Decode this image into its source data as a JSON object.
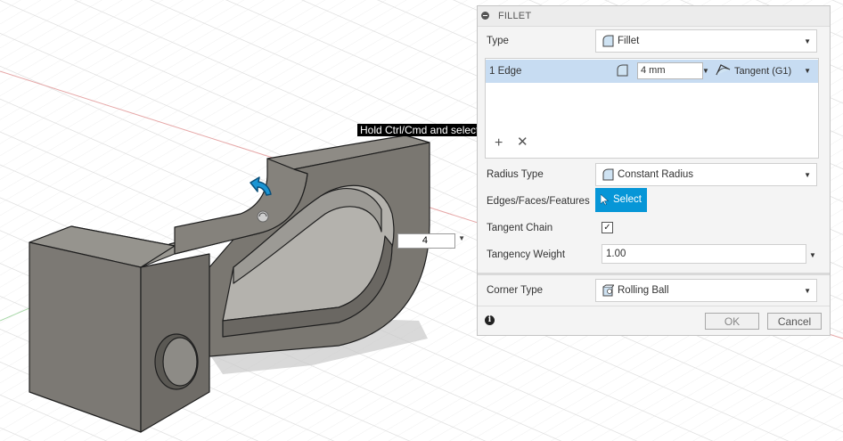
{
  "tooltip": "Hold Ctrl/Cmd and select edges, faces, or features to modify selection",
  "inline_input": {
    "value": "4"
  },
  "dialog": {
    "title": "FILLET",
    "type": {
      "label": "Type",
      "value": "Fillet"
    },
    "edges": {
      "label": "1 Edge",
      "radius": "4 mm",
      "continuity": "Tangent (G1)"
    },
    "radius_type": {
      "label": "Radius Type",
      "value": "Constant Radius"
    },
    "edges_faces_features": {
      "label": "Edges/Faces/Features",
      "button": "Select"
    },
    "tangent_chain": {
      "label": "Tangent Chain",
      "checked": true
    },
    "tangency_weight": {
      "label": "Tangency Weight",
      "value": "1.00"
    },
    "corner_type": {
      "label": "Corner Type",
      "value": "Rolling Ball"
    },
    "ok": "OK",
    "cancel": "Cancel"
  },
  "colors": {
    "accent": "#0696d7",
    "selection_row": "#c7dcf2",
    "model_gray": "#8a8780"
  },
  "icons": [
    "fillet-icon",
    "tangent-icon",
    "constant-radius-icon",
    "rolling-ball-icon",
    "cursor-icon",
    "info-icon",
    "add-icon",
    "remove-icon",
    "move-arrow-icon",
    "collapse-icon"
  ]
}
